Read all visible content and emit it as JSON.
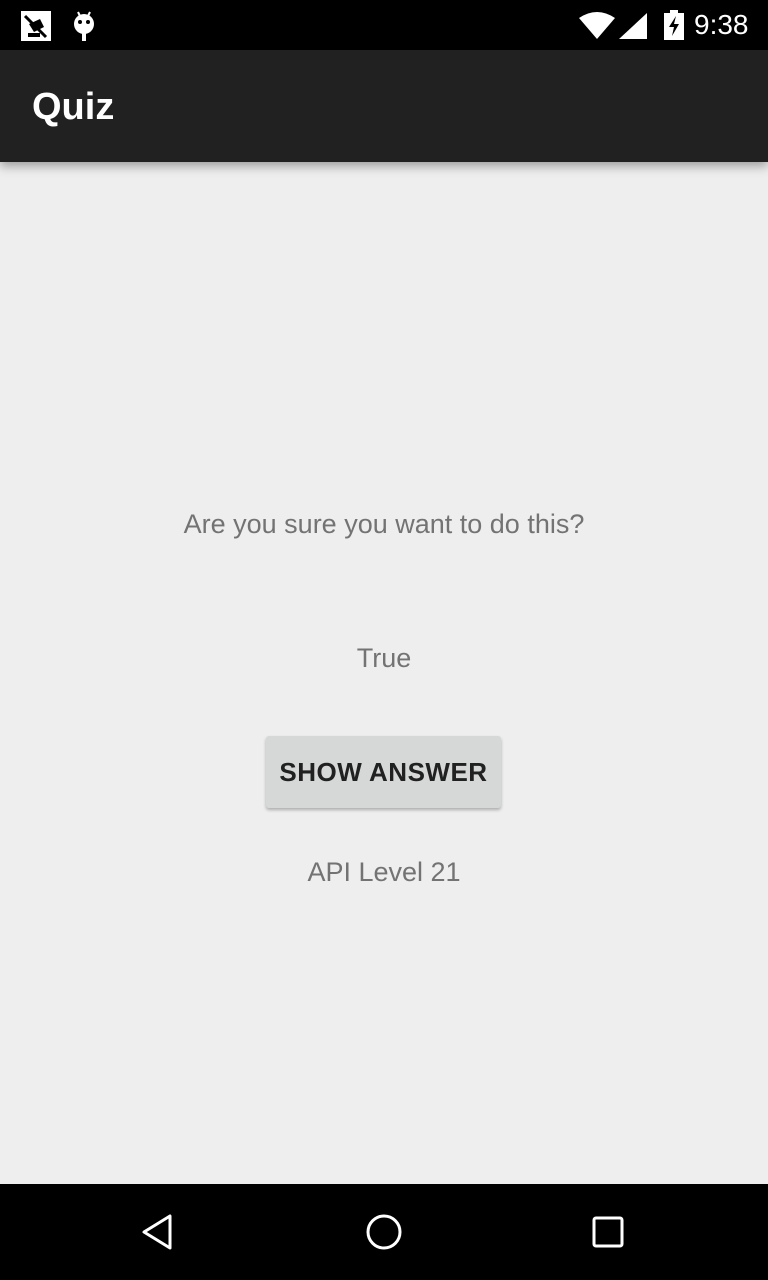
{
  "status_bar": {
    "time": "9:38",
    "icons": [
      "screenshot-notification-icon",
      "android-debug-icon",
      "wifi-icon",
      "cell-signal-icon",
      "battery-charging-icon"
    ]
  },
  "app_bar": {
    "title": "Quiz"
  },
  "main": {
    "question": "Are you sure you want to do this?",
    "answer": "True",
    "show_answer_label": "SHOW ANSWER",
    "api_level": "API Level 21"
  },
  "nav_bar": {
    "icons": [
      "back-icon",
      "home-icon",
      "recents-icon"
    ]
  },
  "colors": {
    "status_bar_bg": "#000000",
    "app_bar_bg": "#212121",
    "content_bg": "#eeeeee",
    "secondary_text": "#737373",
    "button_bg": "#d6d7d7",
    "button_text": "#212121"
  }
}
